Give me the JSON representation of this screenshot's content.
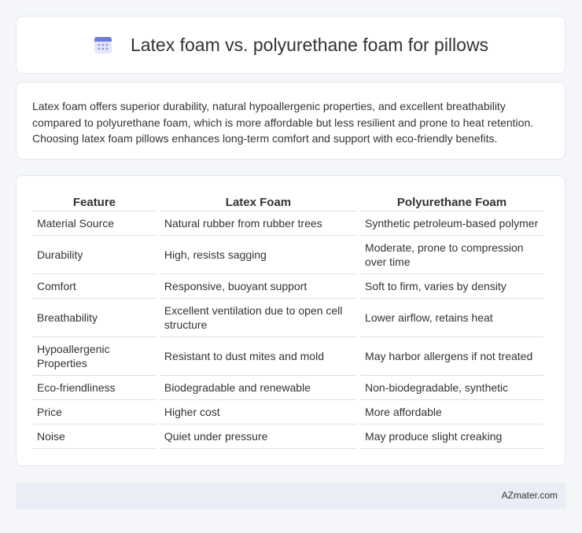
{
  "header": {
    "title": "Latex foam vs. polyurethane foam for pillows",
    "icon": "calendar-icon"
  },
  "summary": {
    "text": "Latex foam offers superior durability, natural hypoallergenic properties, and excellent breathability compared to polyurethane foam, which is more affordable but less resilient and prone to heat retention. Choosing latex foam pillows enhances long-term comfort and support with eco-friendly benefits."
  },
  "table": {
    "headers": [
      "Feature",
      "Latex Foam",
      "Polyurethane Foam"
    ],
    "rows": [
      [
        "Material Source",
        "Natural rubber from rubber trees",
        "Synthetic petroleum-based polymer"
      ],
      [
        "Durability",
        "High, resists sagging",
        "Moderate, prone to compression over time"
      ],
      [
        "Comfort",
        "Responsive, buoyant support",
        "Soft to firm, varies by density"
      ],
      [
        "Breathability",
        "Excellent ventilation due to open cell structure",
        "Lower airflow, retains heat"
      ],
      [
        "Hypoallergenic Properties",
        "Resistant to dust mites and mold",
        "May harbor allergens if not treated"
      ],
      [
        "Eco-friendliness",
        "Biodegradable and renewable",
        "Non-biodegradable, synthetic"
      ],
      [
        "Price",
        "Higher cost",
        "More affordable"
      ],
      [
        "Noise",
        "Quiet under pressure",
        "May produce slight creaking"
      ]
    ]
  },
  "footer": {
    "credit": "AZmater.com"
  },
  "colors": {
    "background": "#f4f6f9",
    "card": "#ffffff",
    "footer_bg": "#e9eef6",
    "icon_accent": "#6b7ee0"
  }
}
